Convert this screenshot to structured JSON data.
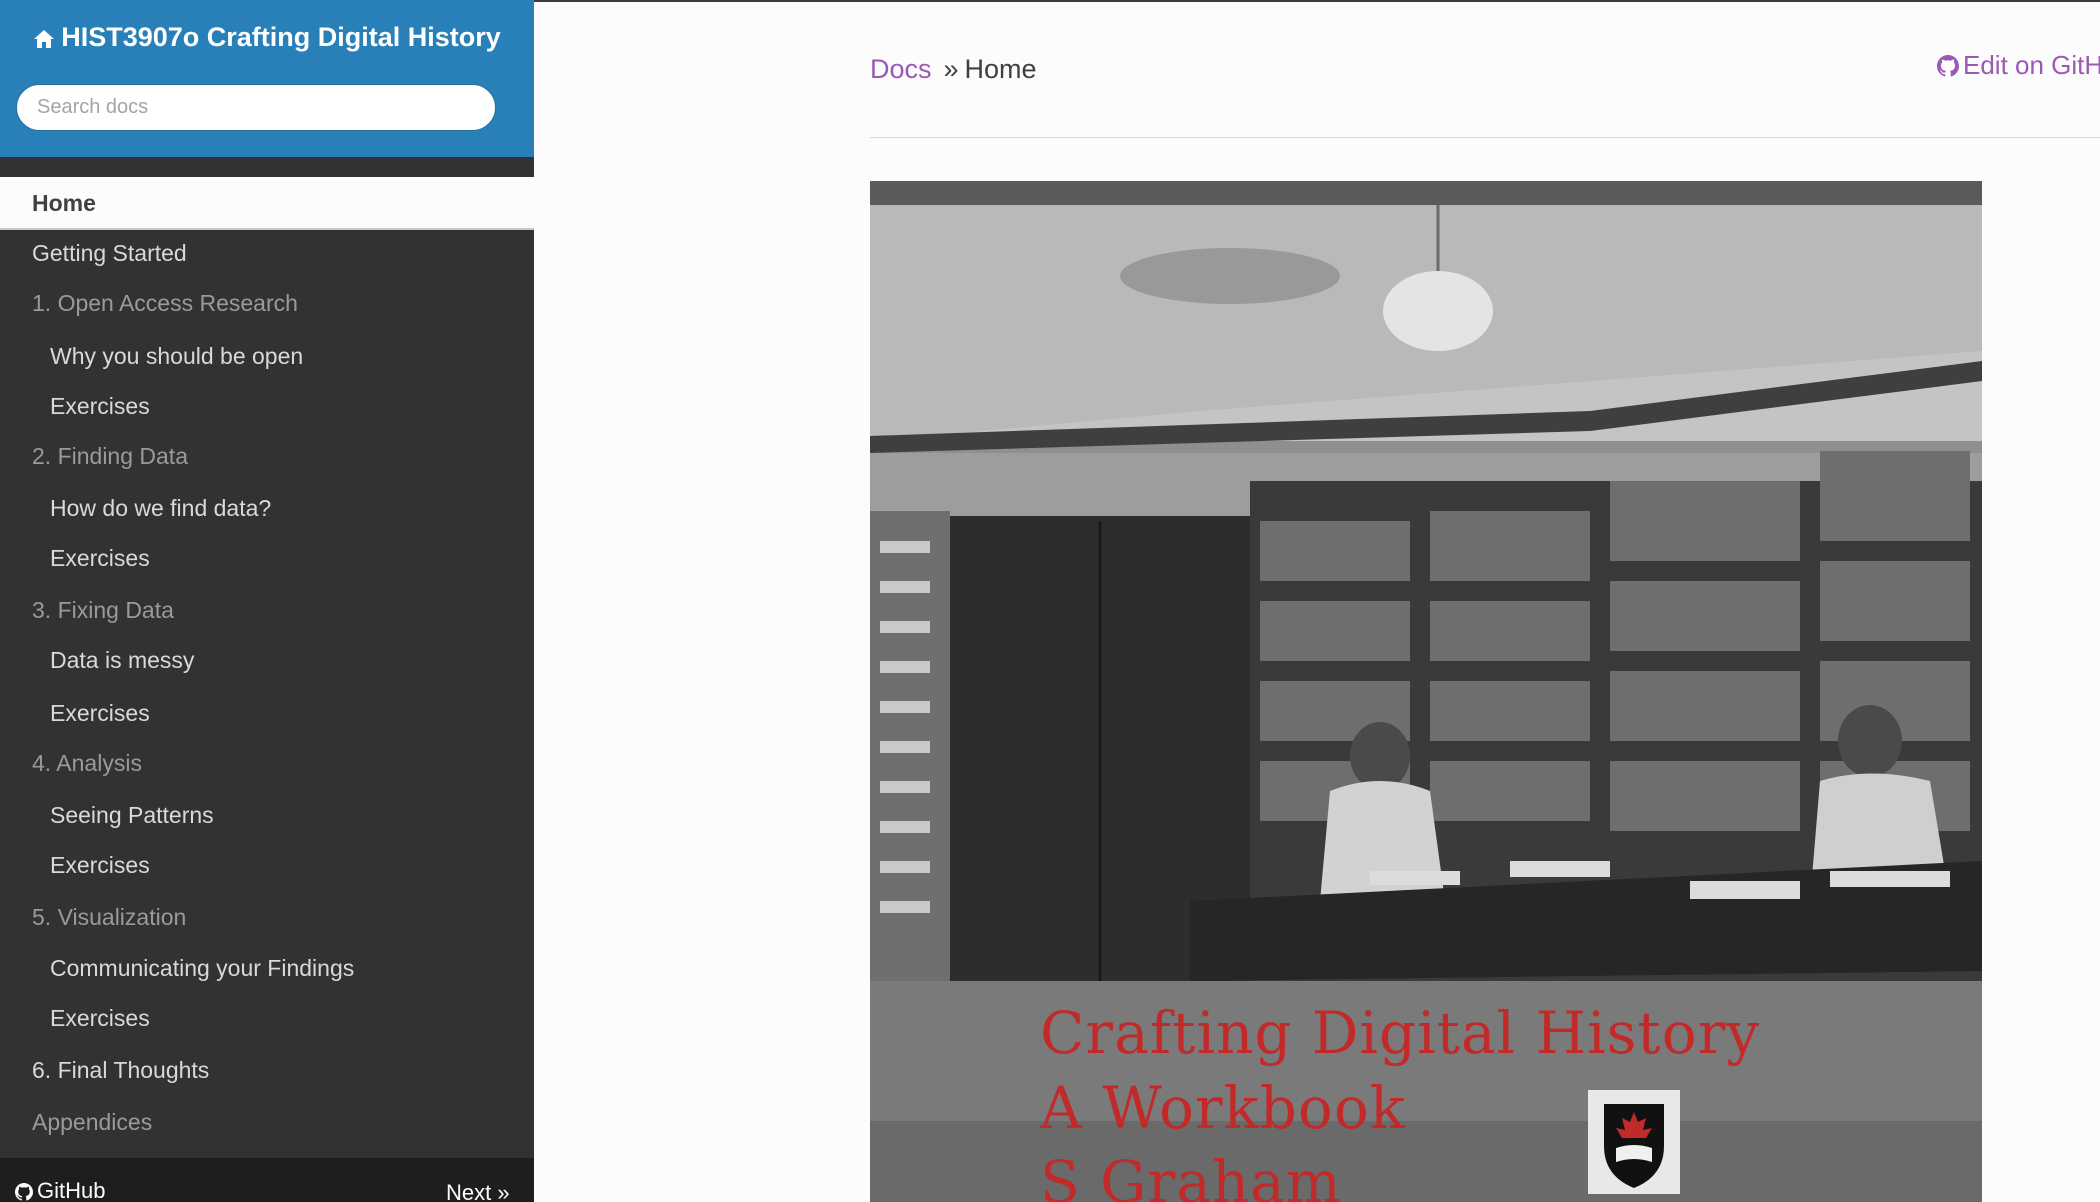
{
  "sidebar": {
    "project_title": "HIST3907o Crafting Digital History",
    "search_placeholder": "Search docs",
    "home_label": "Home",
    "items": [
      {
        "label": "Getting Started",
        "level": "top"
      },
      {
        "label": "1. Open Access Research",
        "level": "caption"
      },
      {
        "label": "Why you should be open",
        "level": "sub"
      },
      {
        "label": "Exercises",
        "level": "sub"
      },
      {
        "label": "2. Finding Data",
        "level": "caption"
      },
      {
        "label": "How do we find data?",
        "level": "sub"
      },
      {
        "label": "Exercises",
        "level": "sub"
      },
      {
        "label": "3. Fixing Data",
        "level": "caption"
      },
      {
        "label": "Data is messy",
        "level": "sub"
      },
      {
        "label": "Exercises",
        "level": "sub"
      },
      {
        "label": "4. Analysis",
        "level": "caption"
      },
      {
        "label": "Seeing Patterns",
        "level": "sub"
      },
      {
        "label": "Exercises",
        "level": "sub"
      },
      {
        "label": "5. Visualization",
        "level": "caption"
      },
      {
        "label": "Communicating your Findings",
        "level": "sub"
      },
      {
        "label": "Exercises",
        "level": "sub"
      },
      {
        "label": "6. Final Thoughts",
        "level": "top"
      },
      {
        "label": "Appendices",
        "level": "caption"
      }
    ],
    "footer": {
      "github_label": "GitHub",
      "next_label": "Next »"
    }
  },
  "breadcrumb": {
    "docs_label": "Docs",
    "separator": "»",
    "current": "Home",
    "edit_label": "Edit on GitHub"
  },
  "cover": {
    "line1": "Crafting Digital History",
    "line2": "A Workbook",
    "line3": "S Graham"
  },
  "colors": {
    "sidebar_header": "#2980b9",
    "sidebar_bg": "#343131",
    "link": "#9b59b6",
    "cover_text": "#c22a2a"
  },
  "icons": {
    "home": "home-icon",
    "github": "github-icon"
  }
}
